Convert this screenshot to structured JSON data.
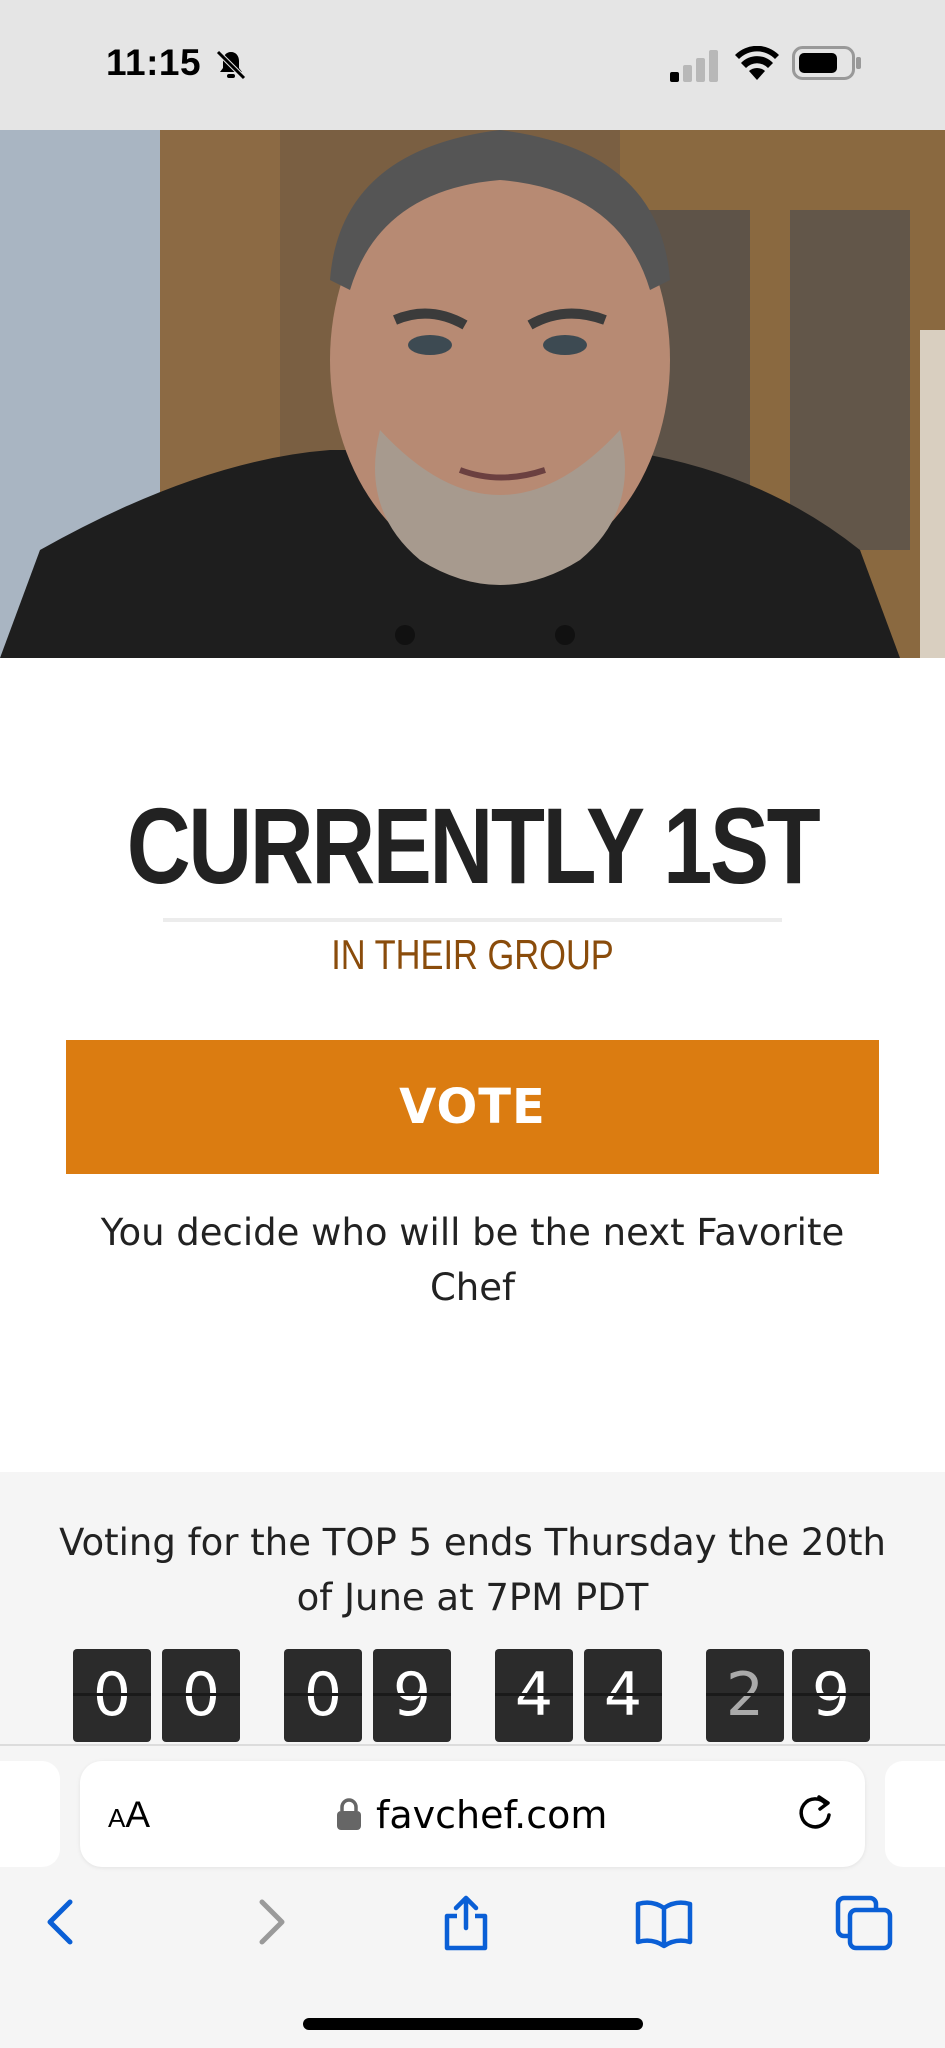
{
  "status_bar": {
    "time": "11:15",
    "icons": [
      "bell-slash-icon",
      "cellular-signal-icon",
      "wifi-icon",
      "battery-icon"
    ]
  },
  "hero": {
    "image": "chef-portrait"
  },
  "ranking": {
    "title": "CURRENTLY 1ST",
    "subtitle": "IN THEIR GROUP"
  },
  "vote": {
    "label": "VOTE",
    "color": "#db7c11"
  },
  "decide_text": "You decide who will be the next Favorite Chef",
  "countdown": {
    "text": "Voting for the TOP 5 ends Thursday the 20th of June at 7PM PDT",
    "digits": [
      "0",
      "0",
      "0",
      "9",
      "4",
      "4",
      "2",
      "9"
    ]
  },
  "browser": {
    "text_size_small": "A",
    "text_size_big": "A",
    "url": "favchef.com",
    "icons": [
      "lock-icon",
      "reload-icon"
    ]
  },
  "toolbar": {
    "icons": [
      "back-icon",
      "forward-icon",
      "share-icon",
      "bookmarks-icon",
      "tabs-icon"
    ]
  },
  "colors": {
    "accent": "#db7c11",
    "subtitle": "#8a4c0b",
    "toolbar_icon": "#0a5fd6"
  }
}
